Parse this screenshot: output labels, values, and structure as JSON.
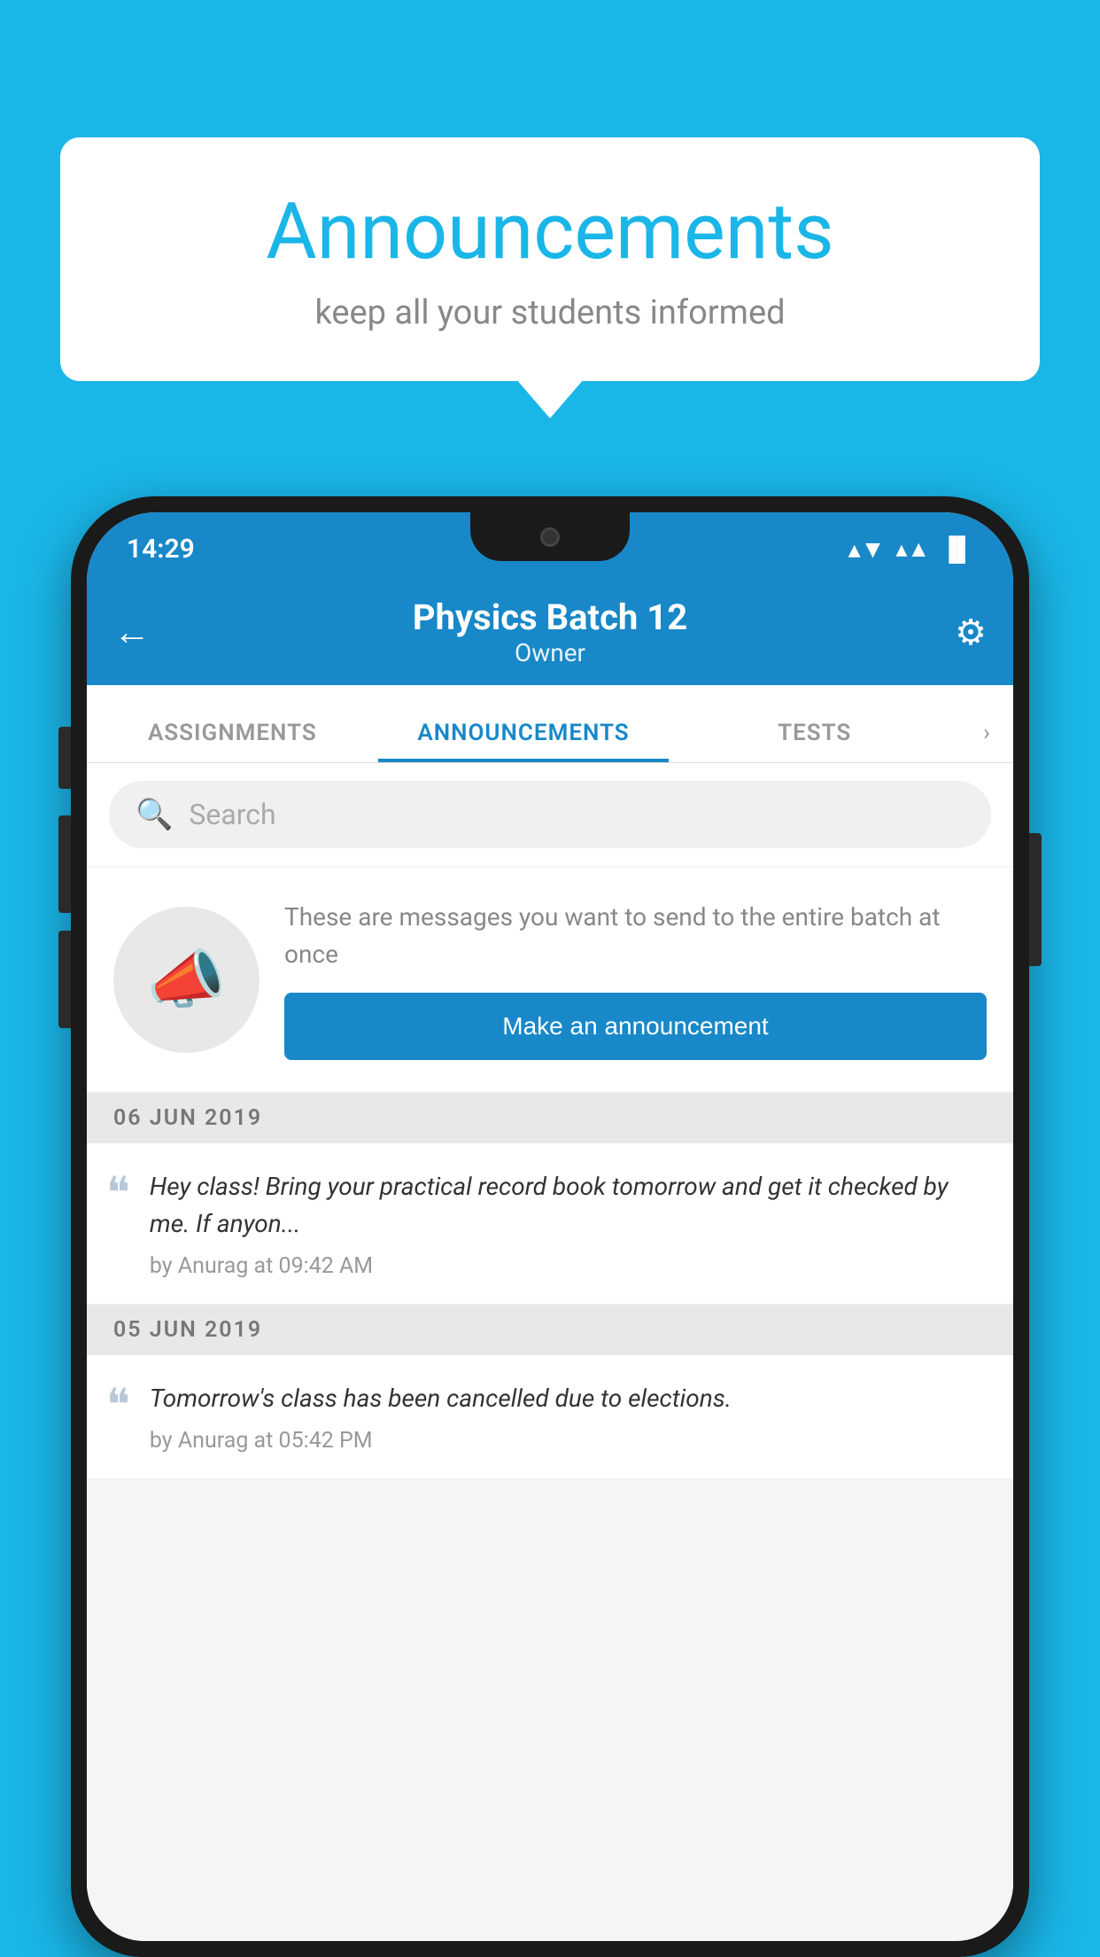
{
  "background_color": "#1ab6e8",
  "speech_bubble": {
    "title": "Announcements",
    "subtitle": "keep all your students informed"
  },
  "status_bar": {
    "time": "14:29",
    "wifi": "▼",
    "signal": "▲",
    "battery": "▐"
  },
  "app_bar": {
    "back_icon": "←",
    "title": "Physics Batch 12",
    "subtitle": "Owner",
    "settings_icon": "⚙"
  },
  "tabs": [
    {
      "label": "ASSIGNMENTS",
      "active": false
    },
    {
      "label": "ANNOUNCEMENTS",
      "active": true
    },
    {
      "label": "TESTS",
      "active": false
    }
  ],
  "search": {
    "placeholder": "Search"
  },
  "promo": {
    "description": "These are messages you want to send to the entire batch at once",
    "button_label": "Make an announcement"
  },
  "date_groups": [
    {
      "date": "06  JUN  2019",
      "items": [
        {
          "text": "Hey class! Bring your practical record book tomorrow and get it checked by me. If anyon...",
          "meta": "by Anurag at 09:42 AM"
        }
      ]
    },
    {
      "date": "05  JUN  2019",
      "items": [
        {
          "text": "Tomorrow's class has been cancelled due to elections.",
          "meta": "by Anurag at 05:42 PM"
        }
      ]
    }
  ]
}
